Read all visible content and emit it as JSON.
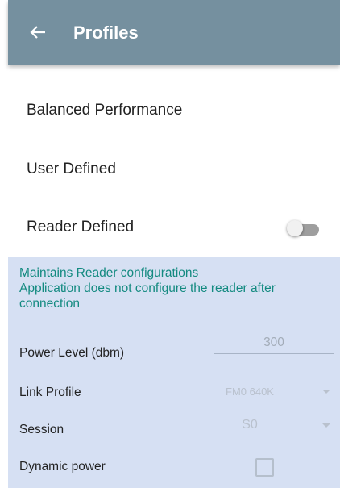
{
  "appbar": {
    "title": "Profiles",
    "back_icon": "arrow-left-icon"
  },
  "profiles": [
    {
      "label": "Balanced Performance"
    },
    {
      "label": "User Defined"
    },
    {
      "label": "Reader Defined",
      "toggle_on": false
    }
  ],
  "reader_defined": {
    "description_line1": "Maintains Reader configurations",
    "description_line2": "Application does not configure the reader after connection",
    "power_level": {
      "label": "Power Level (dbm)",
      "value": "300"
    },
    "link_profile": {
      "label": "Link Profile",
      "value": "FM0 640K"
    },
    "session": {
      "label": "Session",
      "value": "S0"
    },
    "dynamic_power": {
      "label": "Dynamic power",
      "checked": false
    }
  },
  "colors": {
    "appbar": "#75909f",
    "accent_text": "#138a80",
    "panel_bg": "#d6e0f3"
  }
}
